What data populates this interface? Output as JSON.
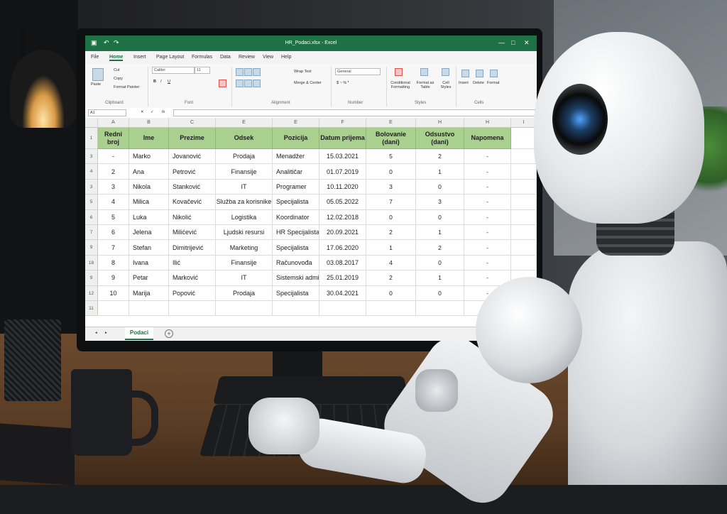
{
  "window": {
    "title": "HR_Podaci.xlsx - Excel",
    "controls": [
      "—",
      "□",
      "✕"
    ]
  },
  "ribbon": {
    "tabs": [
      "File",
      "Home",
      "Insert",
      "Page Layout",
      "Formulas",
      "Data",
      "Review",
      "View",
      "Help"
    ],
    "active_tab": "Home",
    "clipboard": {
      "cut": "Cut",
      "copy": "Copy",
      "format_painter": "Format Painter",
      "paste": "Paste",
      "label": "Clipboard"
    },
    "font": {
      "name": "Calibri",
      "size": "11",
      "label": "Font"
    },
    "alignment": {
      "wrap": "Wrap Text",
      "merge": "Merge & Center",
      "label": "Alignment"
    },
    "number": {
      "format": "General",
      "label": "Number"
    },
    "styles": {
      "conditional": "Conditional Formatting",
      "as_table": "Format as Table",
      "cell_styles": "Cell Styles",
      "label": "Styles"
    },
    "cells": {
      "insert": "Insert",
      "delete": "Delete",
      "format": "Format",
      "label": "Cells"
    }
  },
  "formula_bar": {
    "name_box": "A1",
    "fx": "fx"
  },
  "columns": [
    "A",
    "B",
    "C",
    "E",
    "E",
    "F",
    "E",
    "H",
    "H",
    "I"
  ],
  "headers": [
    "Redni broj",
    "Ime",
    "Prezime",
    "Odsek",
    "Pozicija",
    "Datum prijema",
    "Bolovanie (dani)",
    "Odsustvo (dani)",
    "Napomena"
  ],
  "row_numbers": [
    "1",
    "3",
    "4",
    "3",
    "5",
    "6",
    "7",
    "9",
    "18",
    "9",
    "12",
    "11"
  ],
  "rows": [
    [
      "-",
      "Marko",
      "Jovanović",
      "Prodaja",
      "Menadžer",
      "15.03.2021",
      "5",
      "2",
      "-"
    ],
    [
      "2",
      "Ana",
      "Petrović",
      "Finansije",
      "Analitičar",
      "01.07.2019",
      "0",
      "1",
      "-"
    ],
    [
      "3",
      "Nikola",
      "Stanković",
      "IT",
      "Programer",
      "10.11.2020",
      "3",
      "0",
      "-"
    ],
    [
      "4",
      "Milica",
      "Kovačević",
      "Služba za korisnike",
      "Specijalista",
      "05.05.2022",
      "7",
      "3",
      "-"
    ],
    [
      "5",
      "Luka",
      "Nikolić",
      "Logistika",
      "Koordinator",
      "12.02.2018",
      "0",
      "0",
      "-"
    ],
    [
      "6",
      "Jelena",
      "Milićević",
      "Ljudski resursi",
      "HR Specijalista",
      "20.09.2021",
      "2",
      "1",
      "-"
    ],
    [
      "7",
      "Stefan",
      "Dimitrijević",
      "Marketing",
      "Specijalista",
      "17.06.2020",
      "1",
      "2",
      "-"
    ],
    [
      "8",
      "Ivana",
      "Ilić",
      "Finansije",
      "Računovođa",
      "03.08.2017",
      "4",
      "0",
      "-"
    ],
    [
      "9",
      "Petar",
      "Marković",
      "IT",
      "Sistemski admin",
      "25.01.2019",
      "2",
      "1",
      "-"
    ],
    [
      "10",
      "Marija",
      "Popović",
      "Prodaja",
      "Specijalista",
      "30.04.2021",
      "0",
      "0",
      "-"
    ]
  ],
  "sheet": {
    "tab": "Podaci",
    "add": "+"
  },
  "colors": {
    "excel_green": "#1e7145",
    "header_fill": "#a9d08e"
  }
}
